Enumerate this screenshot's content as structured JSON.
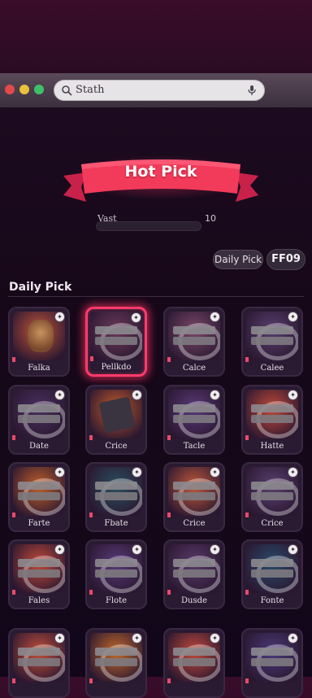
{
  "browser": {
    "search_text": "Stath",
    "icons": [
      "magnifier-icon",
      "microphone-icon"
    ],
    "window_buttons": [
      "close",
      "minimize",
      "maximize"
    ]
  },
  "banner": {
    "title": "Hot Pick"
  },
  "progress": {
    "label": "Vast",
    "max_label": "10",
    "value": 0
  },
  "filters": {
    "daily_pick_label": "Daily Pick",
    "code_label": "FF09"
  },
  "section": {
    "title": "Daily Pick"
  },
  "cards": [
    {
      "name": "Falka",
      "style": "portrait",
      "bg": "#c2553a",
      "selected": false
    },
    {
      "name": "Pellkdo",
      "style": "mask",
      "bg": "#6b3a5a",
      "selected": true
    },
    {
      "name": "Calce",
      "style": "mask",
      "bg": "#7b4a6a",
      "selected": false
    },
    {
      "name": "Calee",
      "style": "mask",
      "bg": "#5a4070",
      "selected": false
    },
    {
      "name": "Date",
      "style": "mask",
      "bg": "#4a3060",
      "selected": false
    },
    {
      "name": "Crice",
      "style": "box",
      "bg": "#c25a2a",
      "selected": false
    },
    {
      "name": "Tacle",
      "style": "mask",
      "bg": "#5a3a7a",
      "selected": false
    },
    {
      "name": "Hatte",
      "style": "mask",
      "bg": "#c24a3a",
      "selected": false
    },
    {
      "name": "Farte",
      "style": "mask",
      "bg": "#c2602a",
      "selected": false
    },
    {
      "name": "Fbate",
      "style": "mask",
      "bg": "#2a5060",
      "selected": false
    },
    {
      "name": "Crice",
      "style": "mask",
      "bg": "#c25a3a",
      "selected": false
    },
    {
      "name": "Crice",
      "style": "mask",
      "bg": "#5a4070",
      "selected": false
    },
    {
      "name": "Fales",
      "style": "mask",
      "bg": "#c24a3a",
      "selected": false
    },
    {
      "name": "Flote",
      "style": "mask",
      "bg": "#5a3a7a",
      "selected": false
    },
    {
      "name": "Dusde",
      "style": "mask",
      "bg": "#5a3a6a",
      "selected": false
    },
    {
      "name": "Fonte",
      "style": "mask",
      "bg": "#2a4a6a",
      "selected": false
    },
    {
      "name": "",
      "style": "mask",
      "bg": "#c2503a",
      "selected": false
    },
    {
      "name": "",
      "style": "mask",
      "bg": "#c26a2a",
      "selected": false
    },
    {
      "name": "",
      "style": "mask",
      "bg": "#c24a3a",
      "selected": false
    },
    {
      "name": "",
      "style": "mask",
      "bg": "#4a3a7a",
      "selected": false
    }
  ],
  "colors": {
    "accent": "#ff3b6b",
    "ribbon": "#f23a5a",
    "background": "#160818",
    "card_border": "#3a2842"
  }
}
